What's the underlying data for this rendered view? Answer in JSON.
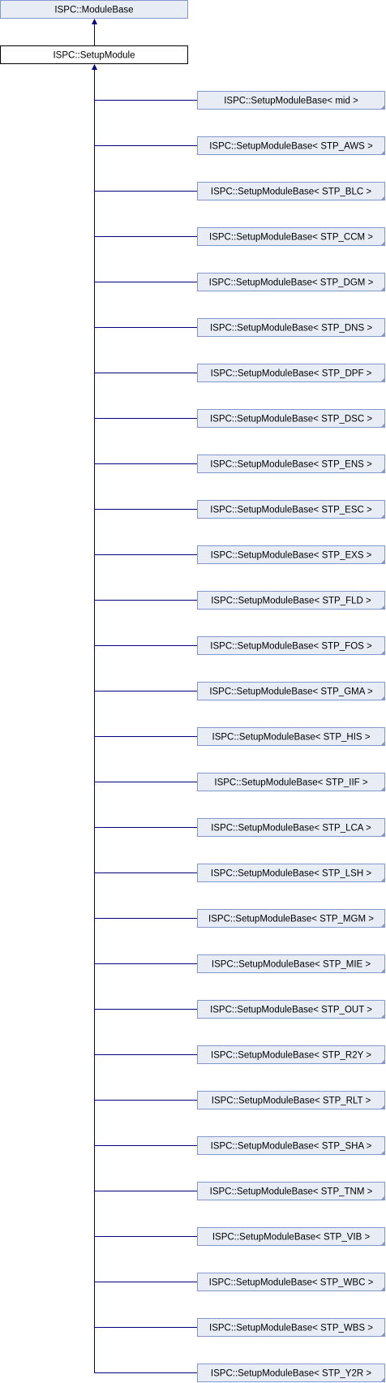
{
  "diagram": {
    "base_class": "ISPC::ModuleBase",
    "current_class": "ISPC::SetupModule",
    "derived_classes": [
      "ISPC::SetupModuleBase< mid >",
      "ISPC::SetupModuleBase< STP_AWS >",
      "ISPC::SetupModuleBase< STP_BLC >",
      "ISPC::SetupModuleBase< STP_CCM >",
      "ISPC::SetupModuleBase< STP_DGM >",
      "ISPC::SetupModuleBase< STP_DNS >",
      "ISPC::SetupModuleBase< STP_DPF >",
      "ISPC::SetupModuleBase< STP_DSC >",
      "ISPC::SetupModuleBase< STP_ENS >",
      "ISPC::SetupModuleBase< STP_ESC >",
      "ISPC::SetupModuleBase< STP_EXS >",
      "ISPC::SetupModuleBase< STP_FLD >",
      "ISPC::SetupModuleBase< STP_FOS >",
      "ISPC::SetupModuleBase< STP_GMA >",
      "ISPC::SetupModuleBase< STP_HIS >",
      "ISPC::SetupModuleBase< STP_IIF >",
      "ISPC::SetupModuleBase< STP_LCA >",
      "ISPC::SetupModuleBase< STP_LSH >",
      "ISPC::SetupModuleBase< STP_MGM >",
      "ISPC::SetupModuleBase< STP_MIE >",
      "ISPC::SetupModuleBase< STP_OUT >",
      "ISPC::SetupModuleBase< STP_R2Y >",
      "ISPC::SetupModuleBase< STP_RLT >",
      "ISPC::SetupModuleBase< STP_SHA >",
      "ISPC::SetupModuleBase< STP_TNM >",
      "ISPC::SetupModuleBase< STP_VIB >",
      "ISPC::SetupModuleBase< STP_WBC >",
      "ISPC::SetupModuleBase< STP_WBS >",
      "ISPC::SetupModuleBase< STP_Y2R >"
    ]
  },
  "colors": {
    "box_fill": "#E8ECF5",
    "box_border": "#8497CC",
    "current_border": "#000000",
    "edge": "#000080"
  }
}
